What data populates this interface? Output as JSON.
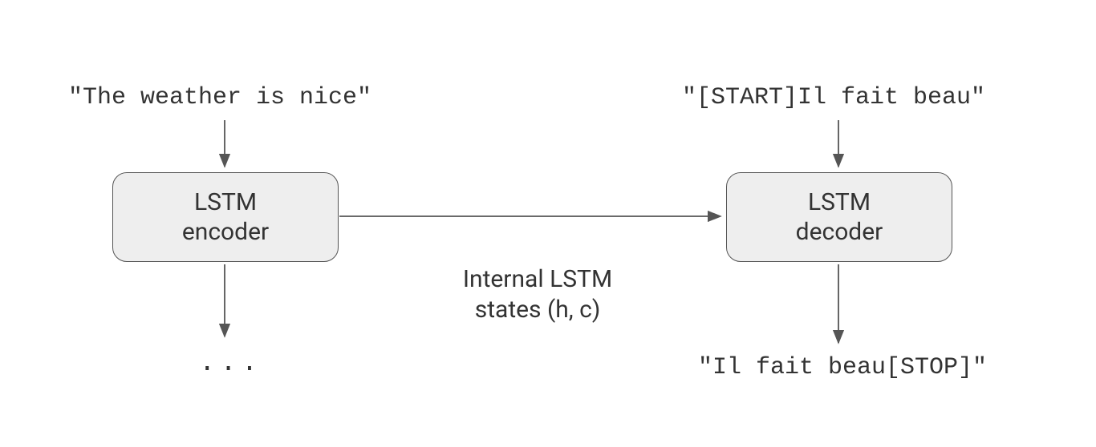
{
  "encoder": {
    "input_text": "\"The weather is nice\"",
    "box_label_line1": "LSTM",
    "box_label_line2": "encoder",
    "output_placeholder": "..."
  },
  "connection": {
    "label_line1": "Internal LSTM",
    "label_line2": "states (h, c)"
  },
  "decoder": {
    "input_text": "\"[START]Il fait beau\"",
    "box_label_line1": "LSTM",
    "box_label_line2": "decoder",
    "output_text": "\"Il fait beau[STOP]\""
  }
}
